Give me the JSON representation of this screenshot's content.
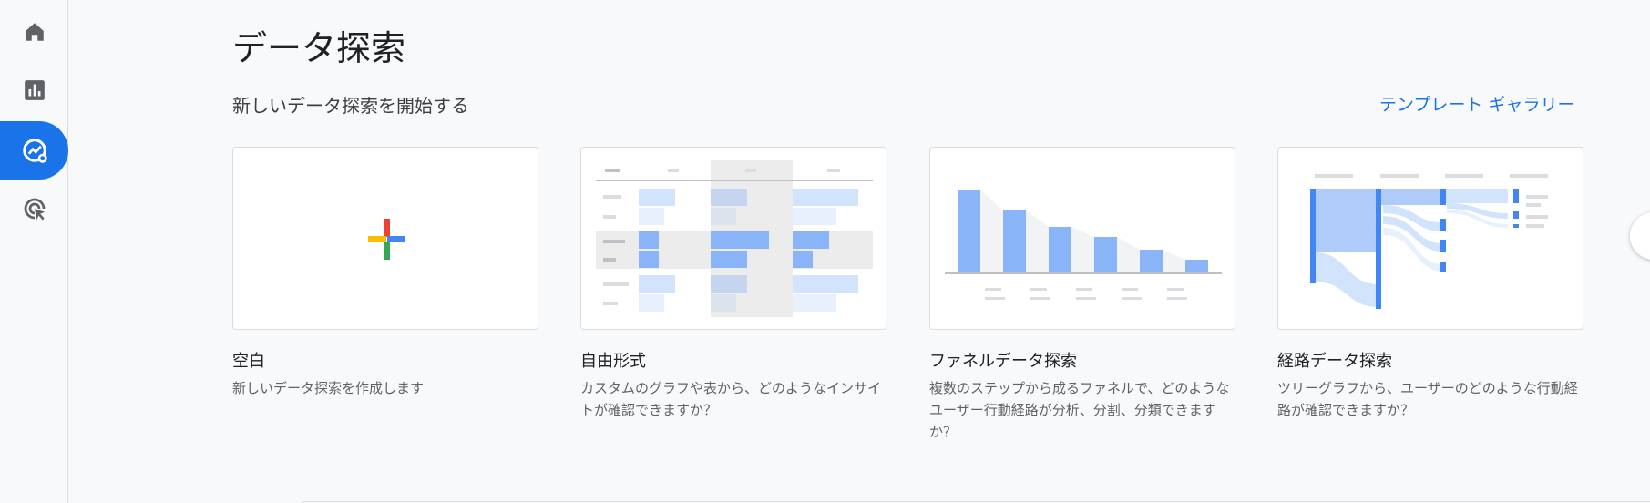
{
  "page": {
    "title": "データ探索",
    "subtitle": "新しいデータ探索を開始する",
    "template_gallery_link": "テンプレート ギャラリー"
  },
  "sidebar": {
    "items": [
      {
        "icon": "home-icon",
        "active": false
      },
      {
        "icon": "reports-icon",
        "active": false
      },
      {
        "icon": "explore-icon",
        "active": true
      },
      {
        "icon": "advertising-icon",
        "active": false
      }
    ]
  },
  "cards": [
    {
      "title": "空白",
      "description": "新しいデータ探索を作成します",
      "thumbnail": "plus-icon"
    },
    {
      "title": "自由形式",
      "description": "カスタムのグラフや表から、どのようなインサイトが確認できますか？",
      "thumbnail": "table-illustration"
    },
    {
      "title": "ファネルデータ探索",
      "description": "複数のステップから成るファネルで、どのようなユーザー行動経路が分析、分割、分類できますか？",
      "thumbnail": "funnel-illustration"
    },
    {
      "title": "経路データ探索",
      "description": "ツリーグラフから、ユーザーのどのような行動経路が確認できますか？",
      "thumbnail": "path-illustration"
    }
  ],
  "carousel": {
    "next_icon": "chevron-right-icon"
  },
  "colors": {
    "accent": "#1a73e8",
    "bar": "#8ab4f8",
    "bar_light": "#d2e3fc",
    "gray": "#dadce0"
  }
}
